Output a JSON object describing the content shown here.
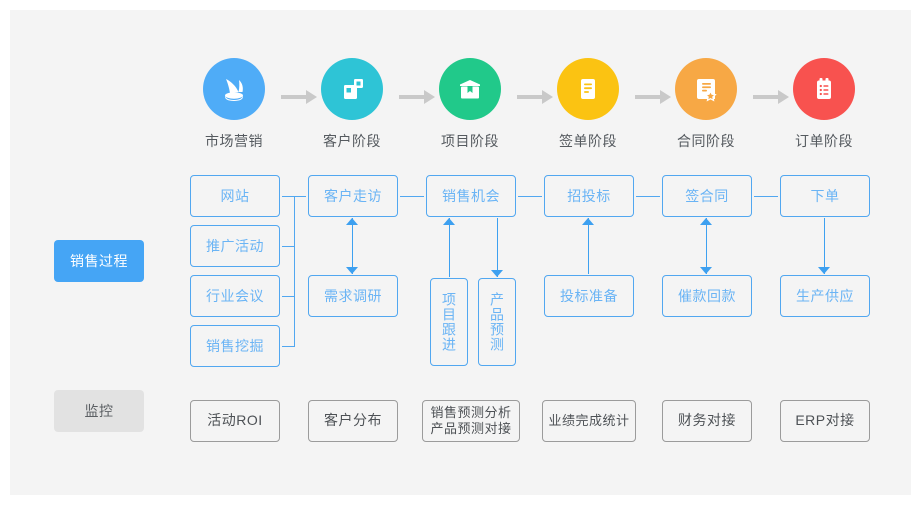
{
  "theme": {
    "page_bg": "#ffffff",
    "canvas_bg": "#f4f4f4",
    "accent_blue": "#45a5f5",
    "box_border_blue": "#51a7f0",
    "box_text_blue": "#6ab4f5",
    "monitor_border": "#9b9b9b",
    "monitor_text": "#4d5155",
    "arrow_gray": "#c9c9c9",
    "tag_gray_bg": "#e2e2e2"
  },
  "stages": [
    {
      "label": "市场营销",
      "icon": "megaphone-icon",
      "color": "#4facf7"
    },
    {
      "label": "客户阶段",
      "icon": "buildings-icon",
      "color": "#2ec4d6"
    },
    {
      "label": "项目阶段",
      "icon": "package-box-icon",
      "color": "#21c98a"
    },
    {
      "label": "签单阶段",
      "icon": "document-lines-icon",
      "color": "#fbc312"
    },
    {
      "label": "合同阶段",
      "icon": "contract-star-icon",
      "color": "#f7a845"
    },
    {
      "label": "订单阶段",
      "icon": "clipboard-list-icon",
      "color": "#f8524f"
    }
  ],
  "arrows_between_stages": 5,
  "rows": {
    "process": {
      "tag": "销售过程"
    },
    "monitor": {
      "tag": "监控"
    }
  },
  "process_top": [
    "网站",
    "客户走访",
    "销售机会",
    "招投标",
    "签合同",
    "下单"
  ],
  "process_left_extra": [
    "推广活动",
    "行业会议",
    "销售挖掘"
  ],
  "process_bottom": {
    "col2": "需求调研",
    "col3_a": "项目跟进",
    "col3_b": "产品预测",
    "col4": "投标准备",
    "col5": "催款回款",
    "col6": "生产供应"
  },
  "vertical_connectors": [
    {
      "from": "客户走访",
      "to": "需求调研",
      "direction": "both"
    },
    {
      "from": "项目跟进",
      "to": "销售机会",
      "direction": "up"
    },
    {
      "from": "销售机会",
      "to": "产品预测",
      "direction": "down"
    },
    {
      "from": "投标准备",
      "to": "招投标",
      "direction": "up"
    },
    {
      "from": "签合同",
      "to": "催款回款",
      "direction": "both"
    },
    {
      "from": "下单",
      "to": "生产供应",
      "direction": "down"
    }
  ],
  "monitor_items": [
    {
      "lines": [
        "活动ROI"
      ]
    },
    {
      "lines": [
        "客户分布"
      ]
    },
    {
      "lines": [
        "销售预测分析",
        "产品预测对接"
      ]
    },
    {
      "lines": [
        "业绩完成统计"
      ]
    },
    {
      "lines": [
        "财务对接"
      ]
    },
    {
      "lines": [
        "ERP对接"
      ]
    }
  ]
}
